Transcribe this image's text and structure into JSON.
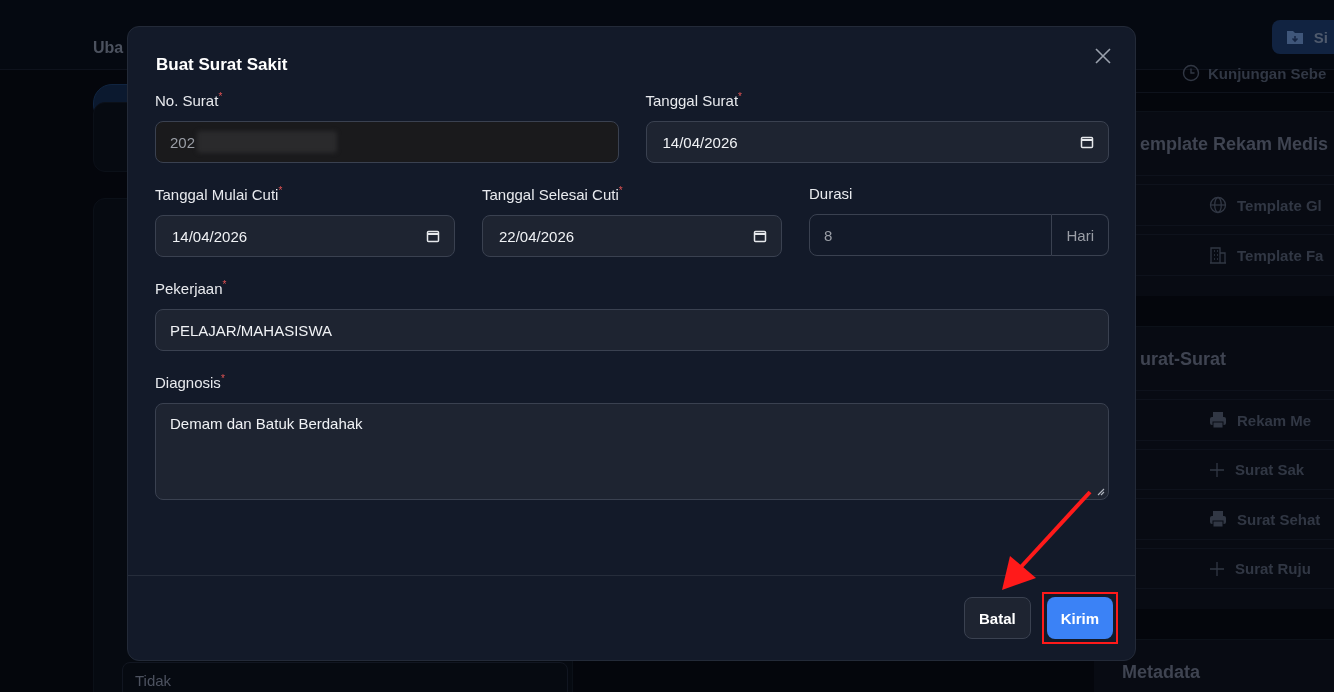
{
  "page": {
    "title": "Uba",
    "left_value": "Tidak",
    "save_button": "Si",
    "visit_link": "Kunjungan Sebe",
    "sections": [
      {
        "title": "emplate Rekam Medis",
        "items": [
          {
            "kind": "global",
            "label": "Template Gl"
          },
          {
            "kind": "facility",
            "label": "Template Fa"
          }
        ]
      },
      {
        "title": "urat-Surat",
        "items": [
          {
            "kind": "print",
            "label": "Rekam Me"
          },
          {
            "kind": "create",
            "label": "Surat Sak"
          },
          {
            "kind": "print",
            "label": "Surat Sehat"
          },
          {
            "kind": "create",
            "label": "Surat Ruju"
          }
        ]
      },
      {
        "title": "Metadata"
      }
    ]
  },
  "modal": {
    "title": "Buat Surat Sakit",
    "rows": [
      {
        "fields": [
          {
            "kind": "text",
            "label": "No. Surat$^{*}$",
            "value": "202",
            "disabled": true,
            "redacted": true
          },
          {
            "kind": "date",
            "label": "Tanggal Surat$^{*}$",
            "value": "14/04/2026",
            "disabled": false
          }
        ]
      },
      {
        "fields": [
          {
            "kind": "date",
            "label": "Tanggal Mulai Cuti$^{*}$",
            "value": "14/04/2026",
            "disabled": false
          },
          {
            "kind": "date",
            "label": "Tanggal Selesai Cuti$^{*}$",
            "value": "22/04/2026",
            "disabled": false
          },
          {
            "kind": "addon",
            "label": "Durasi",
            "value": "8",
            "addon": "Hari",
            "disabled": true
          }
        ]
      },
      {
        "fields": [
          {
            "kind": "text",
            "label": "Pekerjaan$^{*}$",
            "value": "PELAJAR/MAHASISWA",
            "disabled": false
          }
        ]
      },
      {
        "fields": [
          {
            "kind": "textarea",
            "label": "Diagnosis$^{*}$",
            "value": "Demam dan Batuk Berdahak",
            "disabled": false
          }
        ]
      }
    ],
    "buttons": [
      {
        "kind": "secondary",
        "label": "Batal",
        "highlighted": false
      },
      {
        "kind": "primary",
        "label": "Kirim",
        "highlighted": true
      }
    ]
  }
}
